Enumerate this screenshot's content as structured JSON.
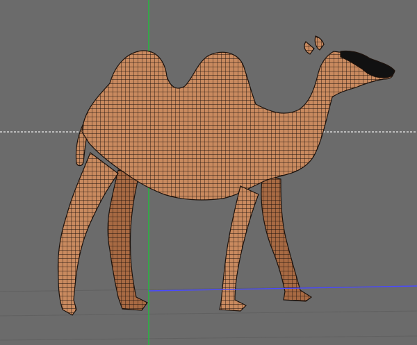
{
  "viewport": {
    "name": "3d-perspective-viewport",
    "background_color": "#6b6b6b",
    "horizon_line_color": "#d7d7d7",
    "grid_line_color": "#5c5c5c",
    "axes": {
      "y_axis_color": "#1fbf3a",
      "x_axis_color": "#4a4aff"
    }
  },
  "model": {
    "subject": "camel",
    "display_mode": "wireframe-on-shaded",
    "surface_color": "#c98a5f",
    "surface_shadow_color": "#a86a43",
    "wire_color": "#1d120c",
    "dark_region_color": "#111111"
  }
}
